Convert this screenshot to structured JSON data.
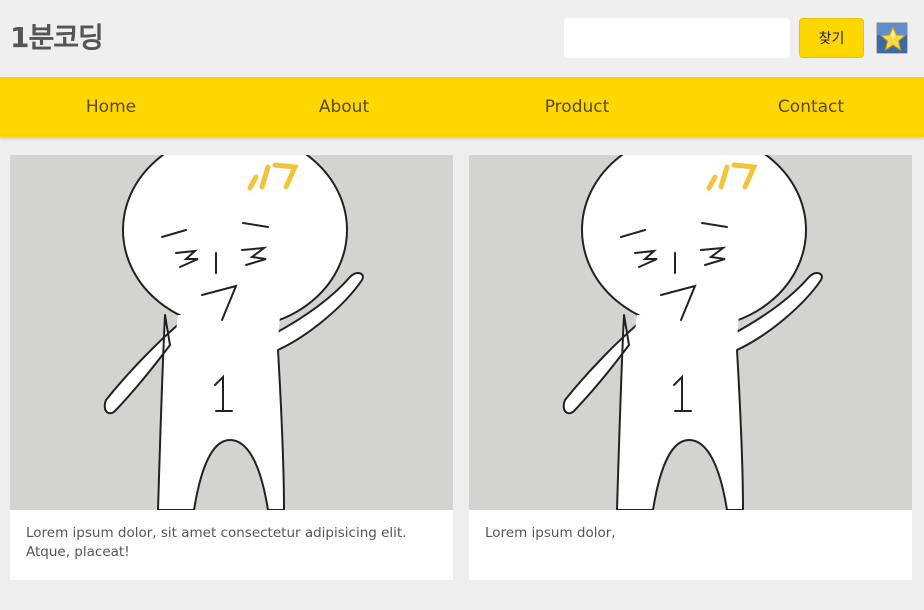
{
  "header": {
    "logo": "1분코딩",
    "search": {
      "value": "",
      "placeholder": ""
    },
    "search_button": "찾기",
    "profile_icon": "star-avatar-icon"
  },
  "nav": {
    "items": [
      {
        "label": "Home"
      },
      {
        "label": "About"
      },
      {
        "label": "Product"
      },
      {
        "label": "Contact"
      }
    ]
  },
  "cards": [
    {
      "image": "character-illustration",
      "text": "Lorem ipsum dolor, sit amet consectetur adipisicing elit. Atque, placeat!"
    },
    {
      "image": "character-illustration",
      "text": "Lorem ipsum dolor,"
    }
  ],
  "colors": {
    "accent": "#ffd700",
    "page_background": "#eeeeee",
    "image_background": "#d3d3d2"
  }
}
